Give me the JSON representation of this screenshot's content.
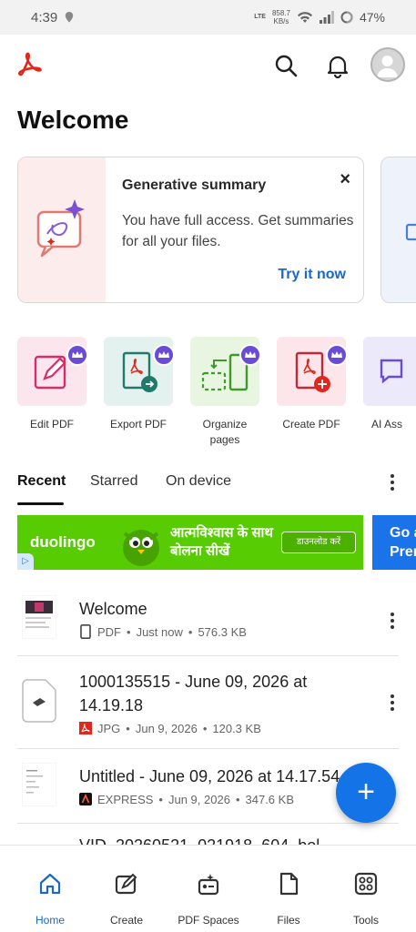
{
  "status_bar": {
    "time": "4:39",
    "speed_value": "858.7",
    "speed_unit": "KB/s",
    "network": "LTE",
    "battery": "47%"
  },
  "header": {
    "search_icon": "search-icon",
    "bell_icon": "bell-icon",
    "avatar_icon": "avatar-icon"
  },
  "page": {
    "title": "Welcome"
  },
  "promo": {
    "title": "Generative summary",
    "body": "You have full access. Get summaries for all your files.",
    "cta": "Try it now",
    "close": "×"
  },
  "tools": [
    {
      "label": "Edit PDF",
      "bg": "#fbe6ee"
    },
    {
      "label": "Export PDF",
      "bg": "#e3f2ee"
    },
    {
      "label": "Organize pages",
      "bg": "#e8f5e1"
    },
    {
      "label": "Create PDF",
      "bg": "#fde6e9"
    },
    {
      "label": "AI Ass",
      "bg": "#ece9fb"
    }
  ],
  "tabs": [
    {
      "label": "Recent"
    },
    {
      "label": "Starred"
    },
    {
      "label": "On device"
    }
  ],
  "ad": {
    "brand": "duolingo",
    "headline_line1": "आत्मविश्वास के साथ",
    "headline_line2": "बोलना सीखें",
    "button": "डाउनलोड करें",
    "info": "▷",
    "second_line1": "Go a",
    "second_line2": "Pren"
  },
  "files": [
    {
      "name": "Welcome",
      "type": "PDF",
      "date": "Just now",
      "size": "576.3 KB"
    },
    {
      "name": "1000135515 - June 09, 2026 at 14.19.18",
      "type": "JPG",
      "date": "Jun 9, 2026",
      "size": "120.3 KB"
    },
    {
      "name": "Untitled - June 09, 2026 at 14.17.54",
      "type": "EXPRESS",
      "date": "Jun 9, 2026",
      "size": "347.6 KB"
    },
    {
      "name": "VID_20260521_021918_604_bol"
    }
  ],
  "meta_separator": "•",
  "fab": "+",
  "nav": [
    {
      "label": "Home"
    },
    {
      "label": "Create"
    },
    {
      "label": "PDF Spaces"
    },
    {
      "label": "Files"
    },
    {
      "label": "Tools"
    }
  ],
  "colors": {
    "accent": "#1473e6",
    "brand_red": "#e3251b",
    "premium": "#6a4bd6"
  }
}
